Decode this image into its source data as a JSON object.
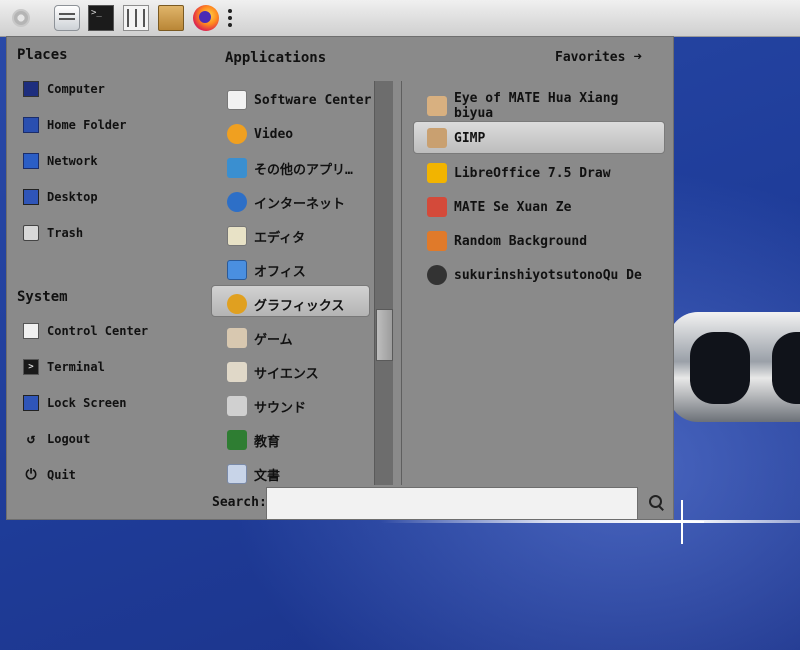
{
  "top_panel": {
    "launchers": [
      {
        "icon": "mate-menu-icon"
      },
      {
        "icon": "file-manager-icon"
      },
      {
        "icon": "terminal-icon"
      },
      {
        "icon": "mixer-icon"
      },
      {
        "icon": "archive-icon"
      },
      {
        "icon": "firefox-icon"
      }
    ]
  },
  "menu": {
    "places_title": "Places",
    "places": [
      {
        "label": "Computer",
        "icon": "computer-icon"
      },
      {
        "label": "Home Folder",
        "icon": "home-folder-icon"
      },
      {
        "label": "Network",
        "icon": "network-icon"
      },
      {
        "label": "Desktop",
        "icon": "desktop-icon"
      },
      {
        "label": "Trash",
        "icon": "trash-icon"
      }
    ],
    "system_title": "System",
    "system": [
      {
        "label": "Control Center",
        "icon": "control-center-icon"
      },
      {
        "label": "Terminal",
        "icon": "terminal-icon"
      },
      {
        "label": "Lock Screen",
        "icon": "lock-screen-icon"
      },
      {
        "label": "Logout",
        "icon": "logout-icon"
      },
      {
        "label": "Quit",
        "icon": "power-icon"
      }
    ],
    "applications_title": "Applications",
    "favorites_label": "Favorites",
    "categories": [
      {
        "label": "Software Center",
        "icon": "software-center-icon",
        "color": "#c0392b"
      },
      {
        "label": "Video",
        "icon": "video-icon",
        "color": "#f0a020"
      },
      {
        "label": "その他のアプリ…",
        "icon": "other-apps-icon",
        "color": "#3a8fd0"
      },
      {
        "label": "インターネット",
        "icon": "internet-icon",
        "color": "#2d6fc7"
      },
      {
        "label": "エディタ",
        "icon": "editor-icon",
        "color": "#e8e2c6"
      },
      {
        "label": "オフィス",
        "icon": "office-icon",
        "color": "#4a8fe0"
      },
      {
        "label": "グラフィックス",
        "icon": "graphics-icon",
        "color": "#e0a020"
      },
      {
        "label": "ゲーム",
        "icon": "games-icon",
        "color": "#d8c8b0"
      },
      {
        "label": "サイエンス",
        "icon": "science-icon",
        "color": "#e0d8c8"
      },
      {
        "label": "サウンド",
        "icon": "sound-icon",
        "color": "#d0d0d0"
      },
      {
        "label": "教育",
        "icon": "education-icon",
        "color": "#2e7d32"
      },
      {
        "label": "文書",
        "icon": "documents-icon",
        "color": "#c8d4e8"
      }
    ],
    "selected_category_index": 6,
    "apps": [
      {
        "label": "Eye of MATE Hua Xiang biyua",
        "icon": "eye-of-mate-icon",
        "color": "#d8b080"
      },
      {
        "label": "GIMP",
        "icon": "gimp-icon",
        "color": "#c9a070"
      },
      {
        "label": "LibreOffice 7.5 Draw",
        "icon": "libreoffice-draw-icon",
        "color": "#f2b400"
      },
      {
        "label": "MATE Se Xuan Ze",
        "icon": "color-picker-icon",
        "color": "#d44a3a"
      },
      {
        "label": "Random Background",
        "icon": "random-background-icon",
        "color": "#e07a2a"
      },
      {
        "label": "sukurinshiyotsutonoQu De",
        "icon": "screenshot-icon",
        "color": "#333333"
      }
    ],
    "selected_app_index": 1,
    "search": {
      "label": "Search:",
      "value": "",
      "placeholder": ""
    }
  }
}
